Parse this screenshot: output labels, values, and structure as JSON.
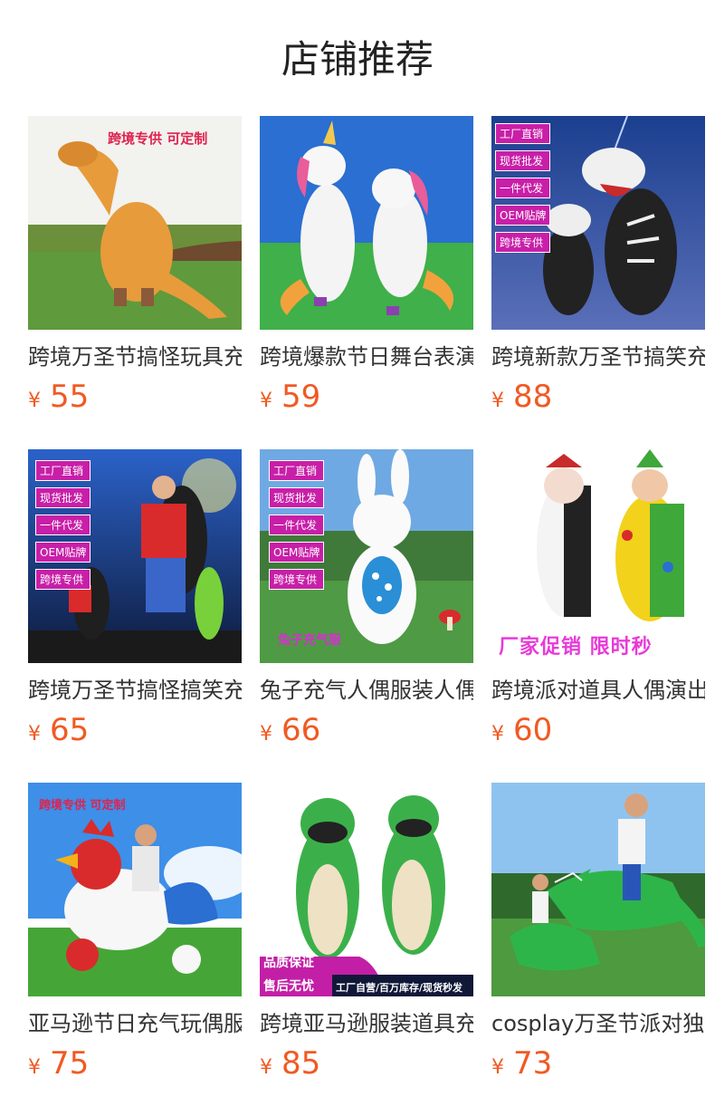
{
  "page": {
    "title": "店铺推荐"
  },
  "currency_symbol": "¥",
  "products": [
    {
      "name": "跨境万圣节搞怪玩具充气",
      "price": "55",
      "overlay": [
        "跨境专供 可定制"
      ],
      "icon": "dinosaur-costume-image"
    },
    {
      "name": "跨境爆款节日舞台表演",
      "price": "59",
      "overlay": [],
      "icon": "unicorn-costume-image"
    },
    {
      "name": "跨境新款万圣节搞笑充气",
      "price": "88",
      "overlay": [
        "工厂直销",
        "现货批发",
        "一件代发",
        "OEM贴牌",
        "跨境专供"
      ],
      "icon": "dragon-costume-image"
    },
    {
      "name": "跨境万圣节搞怪搞笑充气",
      "price": "65",
      "overlay": [
        "工厂直销",
        "现货批发",
        "一件代发",
        "OEM贴牌",
        "跨境专供"
      ],
      "icon": "carry-costume-image"
    },
    {
      "name": "兔子充气人偶服装人偶装",
      "price": "66",
      "overlay": [
        "工厂直销",
        "现货批发",
        "一件代发",
        "OEM贴牌",
        "跨境专供",
        "兔子充气服"
      ],
      "icon": "rabbit-costume-image"
    },
    {
      "name": "跨境派对道具人偶演出服",
      "price": "60",
      "overlay": [
        "厂家促销 限时秒"
      ],
      "icon": "clown-costume-image"
    },
    {
      "name": "亚马逊节日充气玩偶服装",
      "price": "75",
      "overlay": [
        "跨境专供 可定制"
      ],
      "icon": "rooster-costume-image"
    },
    {
      "name": "跨境亚马逊服装道具充气",
      "price": "85",
      "overlay": [
        "品质保证",
        "售后无忧",
        "工厂自营/百万库存/现货秒发"
      ],
      "icon": "frog-costume-image"
    },
    {
      "name": "cosplay万圣节派对独角",
      "price": "73",
      "overlay": [],
      "icon": "crocodile-costume-image"
    }
  ]
}
